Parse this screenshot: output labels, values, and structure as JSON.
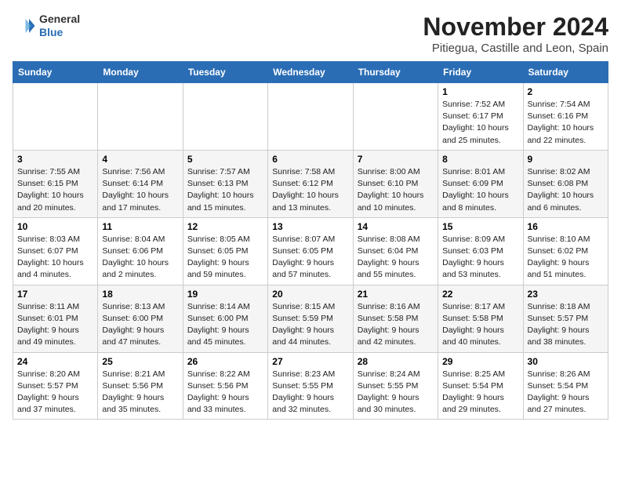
{
  "header": {
    "logo_general": "General",
    "logo_blue": "Blue",
    "month_title": "November 2024",
    "location": "Pitiegua, Castille and Leon, Spain"
  },
  "days_of_week": [
    "Sunday",
    "Monday",
    "Tuesday",
    "Wednesday",
    "Thursday",
    "Friday",
    "Saturday"
  ],
  "weeks": [
    [
      {
        "day": "",
        "info": ""
      },
      {
        "day": "",
        "info": ""
      },
      {
        "day": "",
        "info": ""
      },
      {
        "day": "",
        "info": ""
      },
      {
        "day": "",
        "info": ""
      },
      {
        "day": "1",
        "info": "Sunrise: 7:52 AM\nSunset: 6:17 PM\nDaylight: 10 hours and 25 minutes."
      },
      {
        "day": "2",
        "info": "Sunrise: 7:54 AM\nSunset: 6:16 PM\nDaylight: 10 hours and 22 minutes."
      }
    ],
    [
      {
        "day": "3",
        "info": "Sunrise: 7:55 AM\nSunset: 6:15 PM\nDaylight: 10 hours and 20 minutes."
      },
      {
        "day": "4",
        "info": "Sunrise: 7:56 AM\nSunset: 6:14 PM\nDaylight: 10 hours and 17 minutes."
      },
      {
        "day": "5",
        "info": "Sunrise: 7:57 AM\nSunset: 6:13 PM\nDaylight: 10 hours and 15 minutes."
      },
      {
        "day": "6",
        "info": "Sunrise: 7:58 AM\nSunset: 6:12 PM\nDaylight: 10 hours and 13 minutes."
      },
      {
        "day": "7",
        "info": "Sunrise: 8:00 AM\nSunset: 6:10 PM\nDaylight: 10 hours and 10 minutes."
      },
      {
        "day": "8",
        "info": "Sunrise: 8:01 AM\nSunset: 6:09 PM\nDaylight: 10 hours and 8 minutes."
      },
      {
        "day": "9",
        "info": "Sunrise: 8:02 AM\nSunset: 6:08 PM\nDaylight: 10 hours and 6 minutes."
      }
    ],
    [
      {
        "day": "10",
        "info": "Sunrise: 8:03 AM\nSunset: 6:07 PM\nDaylight: 10 hours and 4 minutes."
      },
      {
        "day": "11",
        "info": "Sunrise: 8:04 AM\nSunset: 6:06 PM\nDaylight: 10 hours and 2 minutes."
      },
      {
        "day": "12",
        "info": "Sunrise: 8:05 AM\nSunset: 6:05 PM\nDaylight: 9 hours and 59 minutes."
      },
      {
        "day": "13",
        "info": "Sunrise: 8:07 AM\nSunset: 6:05 PM\nDaylight: 9 hours and 57 minutes."
      },
      {
        "day": "14",
        "info": "Sunrise: 8:08 AM\nSunset: 6:04 PM\nDaylight: 9 hours and 55 minutes."
      },
      {
        "day": "15",
        "info": "Sunrise: 8:09 AM\nSunset: 6:03 PM\nDaylight: 9 hours and 53 minutes."
      },
      {
        "day": "16",
        "info": "Sunrise: 8:10 AM\nSunset: 6:02 PM\nDaylight: 9 hours and 51 minutes."
      }
    ],
    [
      {
        "day": "17",
        "info": "Sunrise: 8:11 AM\nSunset: 6:01 PM\nDaylight: 9 hours and 49 minutes."
      },
      {
        "day": "18",
        "info": "Sunrise: 8:13 AM\nSunset: 6:00 PM\nDaylight: 9 hours and 47 minutes."
      },
      {
        "day": "19",
        "info": "Sunrise: 8:14 AM\nSunset: 6:00 PM\nDaylight: 9 hours and 45 minutes."
      },
      {
        "day": "20",
        "info": "Sunrise: 8:15 AM\nSunset: 5:59 PM\nDaylight: 9 hours and 44 minutes."
      },
      {
        "day": "21",
        "info": "Sunrise: 8:16 AM\nSunset: 5:58 PM\nDaylight: 9 hours and 42 minutes."
      },
      {
        "day": "22",
        "info": "Sunrise: 8:17 AM\nSunset: 5:58 PM\nDaylight: 9 hours and 40 minutes."
      },
      {
        "day": "23",
        "info": "Sunrise: 8:18 AM\nSunset: 5:57 PM\nDaylight: 9 hours and 38 minutes."
      }
    ],
    [
      {
        "day": "24",
        "info": "Sunrise: 8:20 AM\nSunset: 5:57 PM\nDaylight: 9 hours and 37 minutes."
      },
      {
        "day": "25",
        "info": "Sunrise: 8:21 AM\nSunset: 5:56 PM\nDaylight: 9 hours and 35 minutes."
      },
      {
        "day": "26",
        "info": "Sunrise: 8:22 AM\nSunset: 5:56 PM\nDaylight: 9 hours and 33 minutes."
      },
      {
        "day": "27",
        "info": "Sunrise: 8:23 AM\nSunset: 5:55 PM\nDaylight: 9 hours and 32 minutes."
      },
      {
        "day": "28",
        "info": "Sunrise: 8:24 AM\nSunset: 5:55 PM\nDaylight: 9 hours and 30 minutes."
      },
      {
        "day": "29",
        "info": "Sunrise: 8:25 AM\nSunset: 5:54 PM\nDaylight: 9 hours and 29 minutes."
      },
      {
        "day": "30",
        "info": "Sunrise: 8:26 AM\nSunset: 5:54 PM\nDaylight: 9 hours and 27 minutes."
      }
    ]
  ]
}
